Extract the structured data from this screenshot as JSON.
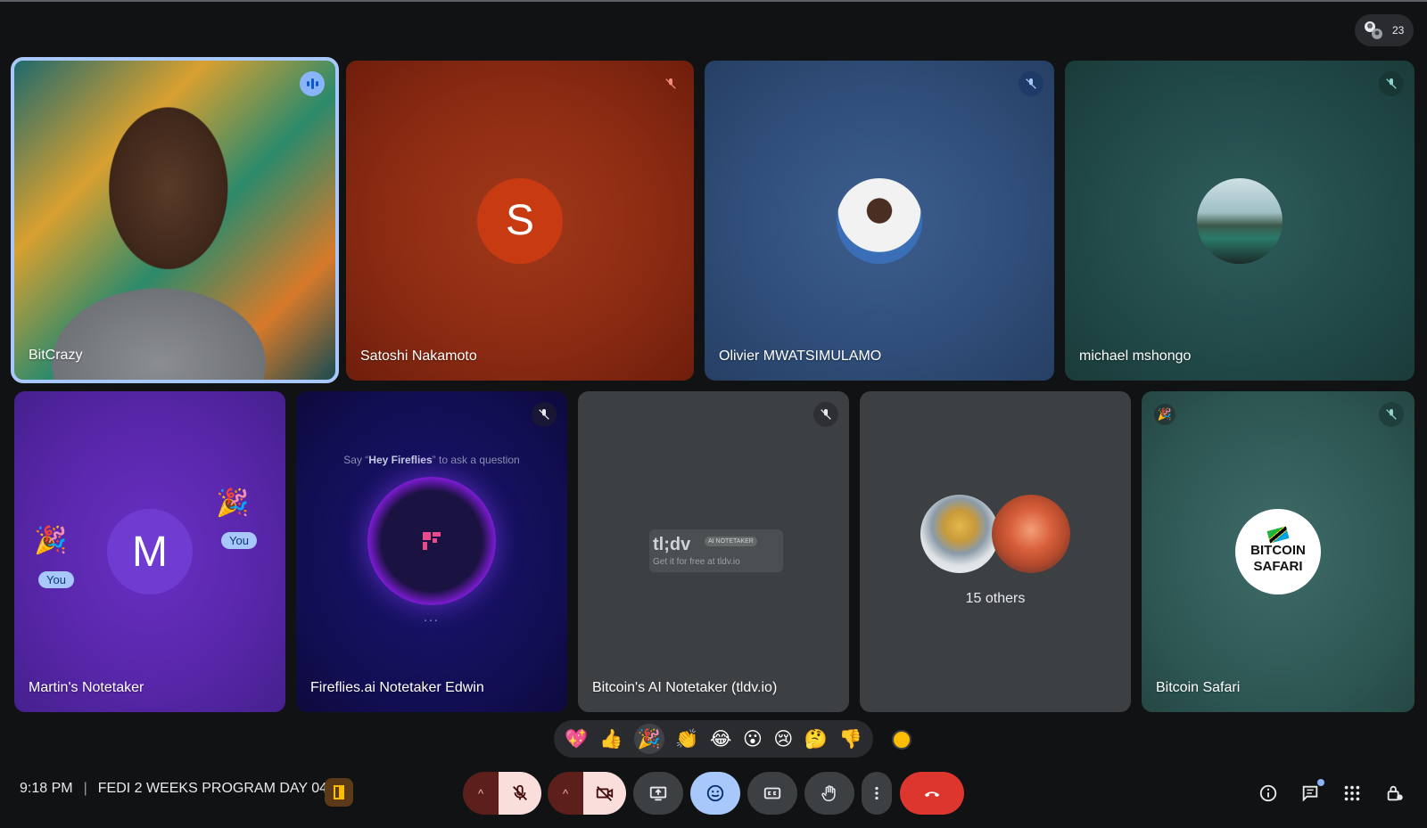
{
  "meeting": {
    "time": "9:18 PM",
    "separator": "|",
    "title": "FEDI 2 WEEKS PROGRAM DAY 04",
    "participant_count": "23"
  },
  "tiles": {
    "bitcrazy": {
      "name": "BitCrazy"
    },
    "satoshi": {
      "name": "Satoshi Nakamoto",
      "initial": "S"
    },
    "olivier": {
      "name": "Olivier MWATSIMULAMO"
    },
    "michael": {
      "name": "michael mshongo"
    },
    "martin": {
      "name": "Martin's Notetaker",
      "initial": "M",
      "you_label_1": "You",
      "you_label_2": "You"
    },
    "fireflies": {
      "name": "Fireflies.ai Notetaker Edwin",
      "hint_pre": "Say “",
      "hint_bold": "Hey Fireflies",
      "hint_post": "” to ask a question",
      "dots": "..."
    },
    "tldv": {
      "name": "Bitcoin's AI Notetaker (tldv.io)",
      "logo_text": "tl;dv",
      "ai_badge": "AI NOTETAKER",
      "sub": "Get it for free at tldv.io"
    },
    "others": {
      "label": "15 others"
    },
    "safari": {
      "name": "Bitcoin Safari",
      "logo_line1": "BITCOIN",
      "logo_line2": "SAFARI"
    }
  },
  "reactions": [
    "💖",
    "👍",
    "🎉",
    "👏",
    "😂",
    "😮",
    "😢",
    "🤔",
    "👎"
  ],
  "colors": {
    "end_call": "#dc362e",
    "mic_off_bg": "#f9dedc",
    "active_blue": "#a8c7fa",
    "speaker_border": "#a8c7fa"
  },
  "icons": {
    "top_right": "people-icon",
    "controls": [
      "mic-off-icon",
      "camera-off-icon",
      "present-icon",
      "emoji-icon",
      "captions-icon",
      "raise-hand-icon",
      "more-vert-icon",
      "end-call-icon"
    ],
    "right": [
      "info-icon",
      "chat-icon",
      "apps-icon",
      "host-controls-icon"
    ]
  }
}
